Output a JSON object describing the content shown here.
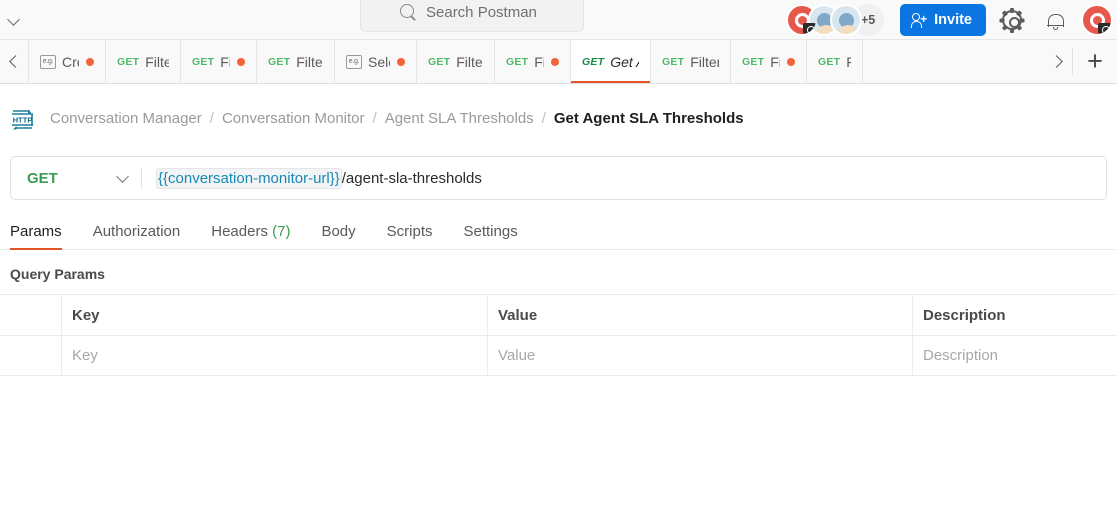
{
  "topbar": {
    "workspace_chevron_icon": "chevron-down-icon",
    "search": {
      "placeholder": "Search Postman",
      "icon": "search-icon"
    },
    "avatar_overflow": "+5",
    "invite_label": "Invite",
    "invite_icon": "person-add-icon",
    "settings_icon": "gear-icon",
    "notifications_icon": "bell-icon",
    "profile_icon": "avatar"
  },
  "tabstrip": {
    "scroll_left_icon": "chevron-left-icon",
    "scroll_right_icon": "chevron-right-icon",
    "new_tab_label": "+",
    "tabs": [
      {
        "kind": "eg",
        "icon_label": "e.g.",
        "label": "Creat",
        "unsaved": true,
        "active": false
      },
      {
        "kind": "get",
        "verb": "GET",
        "label": "Filtere",
        "unsaved": false,
        "active": false
      },
      {
        "kind": "get",
        "verb": "GET",
        "label": "Filter",
        "unsaved": true,
        "active": false
      },
      {
        "kind": "get",
        "verb": "GET",
        "label": "Filtere",
        "unsaved": false,
        "active": false
      },
      {
        "kind": "eg",
        "icon_label": "e.g.",
        "label": "Selec",
        "unsaved": true,
        "active": false
      },
      {
        "kind": "get",
        "verb": "GET",
        "label": "Filtere",
        "unsaved": false,
        "active": false
      },
      {
        "kind": "get",
        "verb": "GET",
        "label": "Filter",
        "unsaved": true,
        "active": false
      },
      {
        "kind": "get",
        "verb": "GET",
        "label": "Get A",
        "unsaved": false,
        "active": true
      },
      {
        "kind": "get",
        "verb": "GET",
        "label": "Filtere",
        "unsaved": false,
        "active": false
      },
      {
        "kind": "get",
        "verb": "GET",
        "label": "Filter",
        "unsaved": true,
        "active": false
      },
      {
        "kind": "get",
        "verb": "GET",
        "label": "Fi",
        "unsaved": false,
        "active": false
      }
    ]
  },
  "breadcrumb": {
    "protocol_icon": "http-icon",
    "items": [
      {
        "label": "Conversation Manager",
        "current": false
      },
      {
        "label": "Conversation Monitor",
        "current": false
      },
      {
        "label": "Agent SLA Thresholds",
        "current": false
      },
      {
        "label": "Get Agent SLA Thresholds",
        "current": true
      }
    ],
    "separator": "/"
  },
  "request": {
    "method": "GET",
    "method_chevron_icon": "chevron-down-icon",
    "url_variable": "{{conversation-monitor-url}}",
    "url_path": "/agent-sla-thresholds"
  },
  "request_tabs": [
    {
      "label": "Params",
      "count": null,
      "active": true
    },
    {
      "label": "Authorization",
      "count": null,
      "active": false
    },
    {
      "label": "Headers",
      "count": "(7)",
      "active": false
    },
    {
      "label": "Body",
      "count": null,
      "active": false
    },
    {
      "label": "Scripts",
      "count": null,
      "active": false
    },
    {
      "label": "Settings",
      "count": null,
      "active": false
    }
  ],
  "query_params": {
    "title": "Query Params",
    "columns": [
      "Key",
      "Value",
      "Description"
    ],
    "rows": [
      {
        "key": "Key",
        "value": "Value",
        "description": "Description",
        "is_placeholder": true
      }
    ]
  },
  "colors": {
    "accent_orange": "#e25528",
    "method_green": "#3a9c54",
    "invite_blue": "#0b75e1",
    "unsaved_dot": "#f2653a",
    "variable_teal": "#1a8ab5"
  }
}
